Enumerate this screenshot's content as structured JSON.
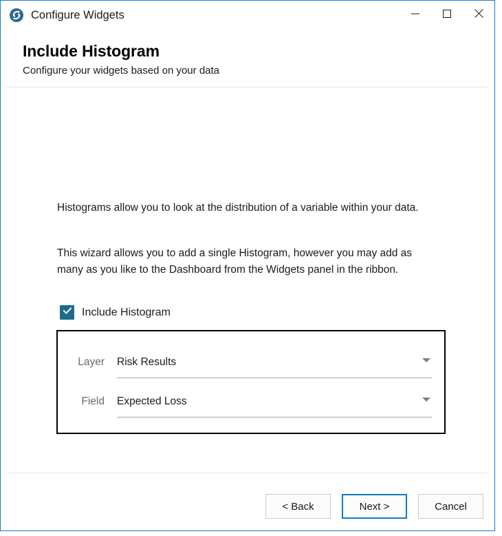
{
  "window": {
    "title": "Configure Widgets",
    "logo_icon": "insight-spiral-logo-icon",
    "controls": {
      "minimize_icon": "minimize-icon",
      "maximize_icon": "maximize-icon",
      "close_icon": "close-icon"
    },
    "border_color": "#1a7ac8"
  },
  "header": {
    "title": "Include Histogram",
    "subtitle": "Configure your widgets based on your data"
  },
  "body": {
    "paragraph_1": "Histograms allow you to look at the distribution of a variable within your data.",
    "paragraph_2": "This wizard allows you to add a single Histogram, however you may add as many as you like to the Dashboard from the Widgets panel in the ribbon.",
    "include_checkbox": {
      "label": "Include Histogram",
      "checked": true,
      "accent_color": "#1f6a8c",
      "check_icon": "checkmark-icon"
    },
    "form": {
      "fields": [
        {
          "label": "Layer",
          "value": "Risk Results",
          "arrow_icon": "chevron-down-icon"
        },
        {
          "label": "Field",
          "value": "Expected Loss",
          "arrow_icon": "chevron-down-icon"
        }
      ]
    }
  },
  "footer": {
    "buttons": [
      {
        "label": "< Back",
        "focused": false
      },
      {
        "label": "Next >",
        "focused": true
      },
      {
        "label": "Cancel",
        "focused": false
      }
    ],
    "focus_color": "#0d7ac4"
  }
}
